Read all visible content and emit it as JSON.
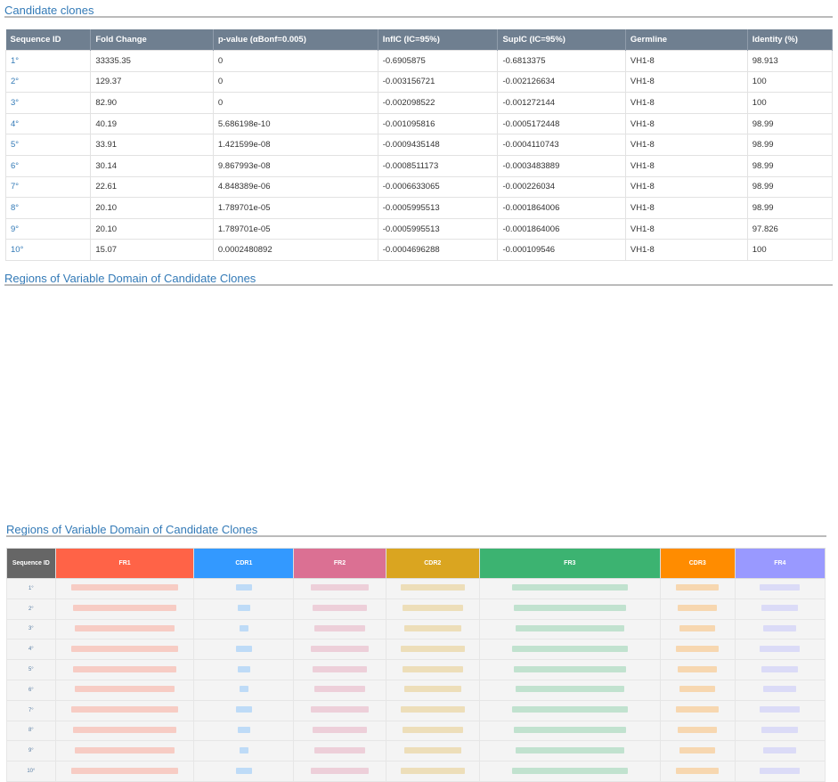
{
  "section1": {
    "title": "Candidate clones"
  },
  "section2": {
    "title": "Regions of Variable Domain of Candidate Clones"
  },
  "section3": {
    "title": "Regions of Variable Domain of Candidate Clones"
  },
  "table1": {
    "headers": [
      "Sequence ID",
      "Fold Change",
      "p-value (αBonf=0.005)",
      "InfIC (IC=95%)",
      "SupIC (IC=95%)",
      "Germline",
      "Identity (%)"
    ],
    "rows": [
      [
        "1°",
        "33335.35",
        "0",
        "-0.6905875",
        "-0.6813375",
        "VH1-8",
        "98.913"
      ],
      [
        "2°",
        "129.37",
        "0",
        "-0.003156721",
        "-0.002126634",
        "VH1-8",
        "100"
      ],
      [
        "3°",
        "82.90",
        "0",
        "-0.002098522",
        "-0.001272144",
        "VH1-8",
        "100"
      ],
      [
        "4°",
        "40.19",
        "5.686198e-10",
        "-0.001095816",
        "-0.0005172448",
        "VH1-8",
        "98.99"
      ],
      [
        "5°",
        "33.91",
        "1.421599e-08",
        "-0.0009435148",
        "-0.0004110743",
        "VH1-8",
        "98.99"
      ],
      [
        "6°",
        "30.14",
        "9.867993e-08",
        "-0.0008511173",
        "-0.0003483889",
        "VH1-8",
        "98.99"
      ],
      [
        "7°",
        "22.61",
        "4.848389e-06",
        "-0.0006633065",
        "-0.000226034",
        "VH1-8",
        "98.99"
      ],
      [
        "8°",
        "20.10",
        "1.789701e-05",
        "-0.0005995513",
        "-0.0001864006",
        "VH1-8",
        "98.99"
      ],
      [
        "9°",
        "20.10",
        "1.789701e-05",
        "-0.0005995513",
        "-0.0001864006",
        "VH1-8",
        "97.826"
      ],
      [
        "10°",
        "15.07",
        "0.0002480892",
        "-0.0004696288",
        "-0.000109546",
        "VH1-8",
        "100"
      ]
    ]
  },
  "table2": {
    "headers": [
      "Sequence ID",
      "FR1",
      "CDR1",
      "FR2",
      "CDR2",
      "FR3",
      "CDR3",
      "FR4"
    ],
    "header_colors": [
      "#666666",
      "#ff6347",
      "#3399ff",
      "#db7093",
      "#daa520",
      "#3cb371",
      "#ff8c00",
      "#9999ff"
    ],
    "row_ids": [
      "1°",
      "2°",
      "3°",
      "4°",
      "5°",
      "6°",
      "7°",
      "8°",
      "9°",
      "10°"
    ]
  }
}
